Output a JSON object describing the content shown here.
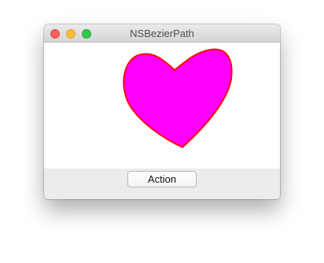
{
  "window": {
    "title": "NSBezierPath"
  },
  "canvas": {
    "shape_icon": "heart-shape",
    "fill_color": "#ff00ff",
    "stroke_color": "#ff0000"
  },
  "footer": {
    "action_label": "Action"
  },
  "colors": {
    "close": "#fc605b",
    "minimize": "#fdbc40",
    "zoom": "#34c84a"
  }
}
